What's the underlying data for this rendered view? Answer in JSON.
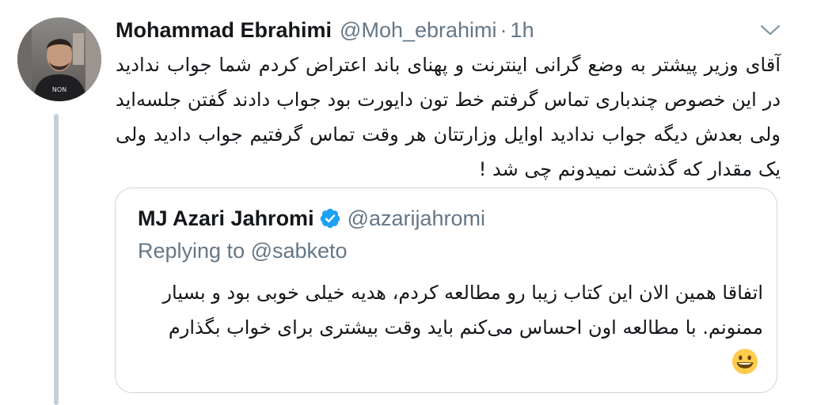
{
  "tweet": {
    "author_name": "Mohammad Ebrahimi",
    "author_handle": "@Moh_ebrahimi",
    "separator": "·",
    "time": "1h",
    "text": "آقای وزیر پیشتر به وضع گرانی اینترنت و پهنای باند اعتراض کردم شما جواب ندادید در این خصوص چندباری تماس گرفتم خط تون دایورت بود جواب دادند گفتن جلسه‌اید ولی بعدش دیگه جواب ندادید اوایل وزارتتان هر وقت تماس گرفتیم جواب دادید ولی یک مقدار که گذشت نمیدونم چی شد !"
  },
  "quoted_tweet": {
    "author_name": "MJ Azari Jahromi",
    "author_handle": "@azarijahromi",
    "replying_to": "Replying to @sabketo",
    "text": "اتفاقا همین الان این کتاب زیبا رو مطالعه کردم، هدیه خیلی خوبی بود و بسیار ممنونم. با مطالعه اون احساس می‌کنم باید وقت بیشتری برای خواب بگذارم",
    "emoji": "grinning-face-emoji"
  },
  "icons": {
    "caret": "chevron-down-icon",
    "verified": "verified-badge-icon"
  },
  "colors": {
    "text_primary": "#14171a",
    "text_secondary": "#657786",
    "verified_blue": "#1da1f2",
    "border": "#ccd6dd",
    "thread_line": "#c4cfd6"
  }
}
